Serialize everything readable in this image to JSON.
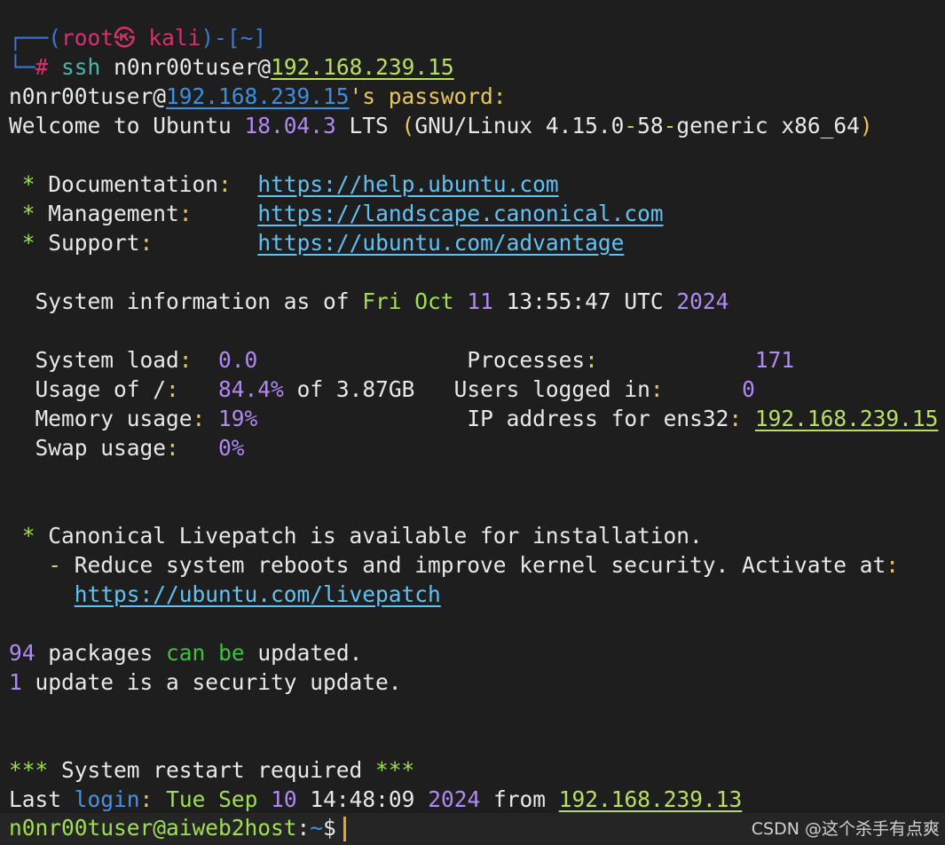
{
  "line1": {
    "box": "┌──",
    "open": "(",
    "root": "root",
    "skull": "㉿",
    "host": "kali",
    "close": ")-[~]"
  },
  "line2": {
    "box": "└─",
    "hash": "#",
    "cmd": "ssh",
    "user_arg": "n0nr00tuser@",
    "ip": "192.168.239.15"
  },
  "line3": {
    "user": "n0nr00tuser@",
    "ip": "192.168.239.15",
    "rest": "'s password:"
  },
  "line4": {
    "p1": "Welcome to Ubuntu ",
    "version": "18.04.3",
    "p2": " LTS ",
    "p3": "(",
    "p4": "GNU/Linux 4.15.0",
    "p5": "-",
    "p6": "58",
    "p7": "-",
    "p8": "generic x86_64",
    "p9": ")"
  },
  "docs": [
    {
      "star": " *",
      "label": " Documentation",
      "colon": ":",
      "pad": "  ",
      "url": "https://help.ubuntu.com"
    },
    {
      "star": " *",
      "label": " Management",
      "colon": ":",
      "pad": "     ",
      "url": "https://landscape.canonical.com"
    },
    {
      "star": " *",
      "label": " Support",
      "colon": ":",
      "pad": "        ",
      "url": "https://ubuntu.com/advantage"
    }
  ],
  "sysinfo": {
    "prefix": "  System information as of ",
    "day": "Fri",
    "month": "Oct",
    "date": "11",
    "time": "13:55:47",
    "tz": "UTC",
    "year": "2024"
  },
  "stats": {
    "load_label": "  System load",
    "load_value": "0.0",
    "processes_label": "Processes",
    "processes_value": "171",
    "usage_label": "  Usage of /",
    "usage_value": "84.4%",
    "usage_of": " of ",
    "usage_total": "3.87GB",
    "users_label": "Users logged in",
    "users_value": "0",
    "mem_label": "  Memory usage",
    "mem_value": "19%",
    "ip_label": "IP address for ens32",
    "ip_value": "192.168.239.15",
    "swap_label": "  Swap usage",
    "swap_value": "0%"
  },
  "livepatch": {
    "star": " *",
    "text": " Canonical Livepatch is available for installation.",
    "dash": "   -",
    "text2": " Reduce system reboots and improve kernel security. Activate at",
    "colon": ":",
    "indent": "     ",
    "url": "https://ubuntu.com/livepatch"
  },
  "packages": {
    "count": "94",
    "t1": " packages ",
    "can": "can",
    "be": "be",
    "t2": " updated."
  },
  "security": {
    "count": "1",
    "t1": " update is a security update."
  },
  "restart": {
    "stars1": "***",
    "text": " System restart required ",
    "stars2": "***"
  },
  "lastlogin": {
    "last": "Last ",
    "login": "login",
    "colon": ":",
    "day": "Tue",
    "month": "Sep",
    "date": "10",
    "time": "14:48:09",
    "year": "2024",
    "from": " from ",
    "ip": "192.168.239.13"
  },
  "prompt": {
    "user_host": "n0nr00tuser@aiweb2host",
    "colon": ":",
    "path": "~",
    "dollar": "$"
  },
  "watermark": "CSDN @这个杀手有点爽"
}
